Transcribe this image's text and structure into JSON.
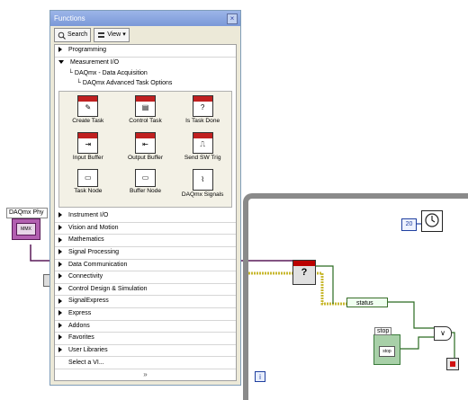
{
  "palette": {
    "title": "Functions",
    "toolbar": {
      "search_label": "Search",
      "view_label": "View"
    },
    "expanded_category": "Measurement I/O",
    "subpath": [
      "DAQmx - Data Acquisition",
      "DAQmx Advanced Task Options"
    ],
    "vis": [
      {
        "label": "Create Task",
        "icon": "create-task-icon"
      },
      {
        "label": "Control Task",
        "icon": "control-task-icon"
      },
      {
        "label": "Is Task Done",
        "icon": "is-task-done-icon"
      },
      {
        "label": "Input Buffer",
        "icon": "input-buffer-icon"
      },
      {
        "label": "Output Buffer",
        "icon": "output-buffer-icon"
      },
      {
        "label": "Send SW Trig",
        "icon": "send-sw-trig-icon"
      },
      {
        "label": "Task Node",
        "icon": "task-node-icon"
      },
      {
        "label": "Buffer Node",
        "icon": "buffer-node-icon"
      },
      {
        "label": "DAQmx Signals",
        "icon": "daqmx-signals-icon"
      }
    ],
    "categories_top": [
      "Programming"
    ],
    "categories_bottom": [
      "Instrument I/O",
      "Vision and Motion",
      "Mathematics",
      "Signal Processing",
      "Data Communication",
      "Connectivity",
      "Control Design & Simulation",
      "SignalExpress",
      "Express",
      "Addons",
      "Favorites",
      "User Libraries"
    ],
    "select_vi_label": "Select a VI...",
    "more_glyph": "»"
  },
  "diagram": {
    "daqmx_control_label": "DAQmx Phy",
    "daqmx_inner": "MMX",
    "constant_value": "20",
    "status_label": "status",
    "stop_label": "stop",
    "stop_button_text": "stop",
    "iteration_label": "i",
    "or_symbol": "∨",
    "istask_glyph": "?"
  },
  "colors": {
    "daq_wire": "#5a1a58",
    "error_wire": "#c8b830",
    "bool_wire": "#2a6a20",
    "loop_border": "#8a8a8a"
  }
}
